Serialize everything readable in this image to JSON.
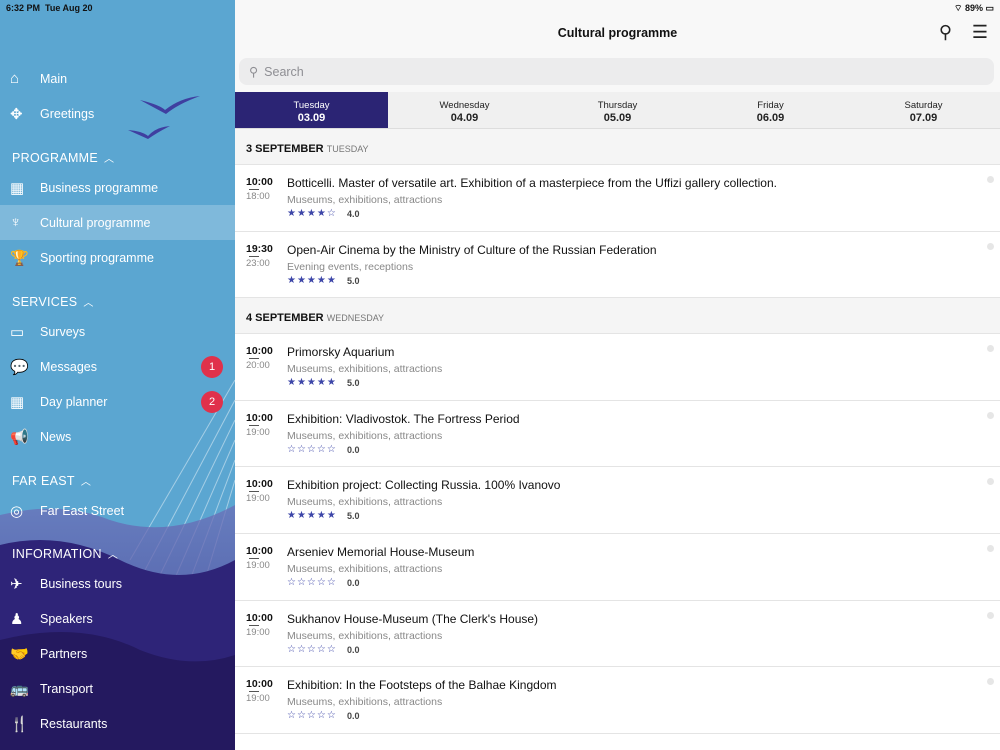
{
  "status": {
    "time": "6:32 PM",
    "date": "Tue Aug 20",
    "battery": "89%"
  },
  "sidebar": {
    "top": [
      {
        "label": "Main",
        "icon": "home-icon",
        "g": "⌂"
      },
      {
        "label": "Greetings",
        "icon": "emblem-icon",
        "g": "✥"
      }
    ],
    "sections": [
      {
        "title": "PROGRAMME",
        "items": [
          {
            "label": "Business programme",
            "icon": "calendar-clock-icon",
            "g": "▦"
          },
          {
            "label": "Cultural programme",
            "icon": "lyre-icon",
            "g": "♆",
            "active": true
          },
          {
            "label": "Sporting programme",
            "icon": "trophy-icon",
            "g": "🏆"
          }
        ]
      },
      {
        "title": "SERVICES",
        "items": [
          {
            "label": "Surveys",
            "icon": "survey-icon",
            "g": "▭"
          },
          {
            "label": "Messages",
            "icon": "chat-icon",
            "g": "💬",
            "badge": "1"
          },
          {
            "label": "Day planner",
            "icon": "calendar-icon",
            "g": "▦",
            "badge": "2"
          },
          {
            "label": "News",
            "icon": "megaphone-icon",
            "g": "📢"
          }
        ]
      },
      {
        "title": "FAR EAST",
        "items": [
          {
            "label": "Far East Street",
            "icon": "far-east-logo-icon",
            "g": "◎"
          }
        ]
      },
      {
        "title": "INFORMATION",
        "items": [
          {
            "label": "Business tours",
            "icon": "plane-icon",
            "g": "✈"
          },
          {
            "label": "Speakers",
            "icon": "speaker-person-icon",
            "g": "♟"
          },
          {
            "label": "Partners",
            "icon": "handshake-icon",
            "g": "🤝"
          },
          {
            "label": "Transport",
            "icon": "bus-icon",
            "g": "🚌"
          },
          {
            "label": "Restaurants",
            "icon": "cutlery-icon",
            "g": "🍴"
          }
        ]
      }
    ]
  },
  "header": {
    "title": "Cultural programme",
    "search_placeholder": "Search"
  },
  "tabs": [
    {
      "day": "Tuesday",
      "date": "03.09",
      "active": true
    },
    {
      "day": "Wednesday",
      "date": "04.09"
    },
    {
      "day": "Thursday",
      "date": "05.09"
    },
    {
      "day": "Friday",
      "date": "06.09"
    },
    {
      "day": "Saturday",
      "date": "07.09"
    }
  ],
  "days": [
    {
      "date": "3 SEPTEMBER",
      "weekday": "TUESDAY",
      "events": [
        {
          "start": "10:00",
          "end": "18:00",
          "name": "Botticelli. Master of versatile art. Exhibition of a masterpiece from the Uffizi gallery collection.",
          "category": "Museums, exhibitions, attractions",
          "rating": "4.0"
        },
        {
          "start": "19:30",
          "end": "23:00",
          "name": "Open-Air Cinema by the Ministry of Culture of the Russian Federation",
          "category": "Evening events, receptions",
          "rating": "5.0"
        }
      ]
    },
    {
      "date": "4 SEPTEMBER",
      "weekday": "WEDNESDAY",
      "events": [
        {
          "start": "10:00",
          "end": "20:00",
          "name": "Primorsky Aquarium",
          "category": "Museums, exhibitions, attractions",
          "rating": "5.0"
        },
        {
          "start": "10:00",
          "end": "19:00",
          "name": "Exhibition: Vladivostok. The Fortress Period",
          "category": "Museums, exhibitions, attractions",
          "rating": "0.0"
        },
        {
          "start": "10:00",
          "end": "19:00",
          "name": "Exhibition project: Collecting Russia. 100% Ivanovo",
          "category": "Museums, exhibitions, attractions",
          "rating": "5.0"
        },
        {
          "start": "10:00",
          "end": "19:00",
          "name": "Arseniev Memorial House-Museum",
          "category": "Museums, exhibitions, attractions",
          "rating": "0.0"
        },
        {
          "start": "10:00",
          "end": "19:00",
          "name": "Sukhanov House-Museum (The Clerk's House)",
          "category": "Museums, exhibitions, attractions",
          "rating": "0.0"
        },
        {
          "start": "10:00",
          "end": "19:00",
          "name": "Exhibition: In the Footsteps of the Balhae Kingdom",
          "category": "Museums, exhibitions, attractions",
          "rating": "0.0"
        }
      ]
    }
  ]
}
